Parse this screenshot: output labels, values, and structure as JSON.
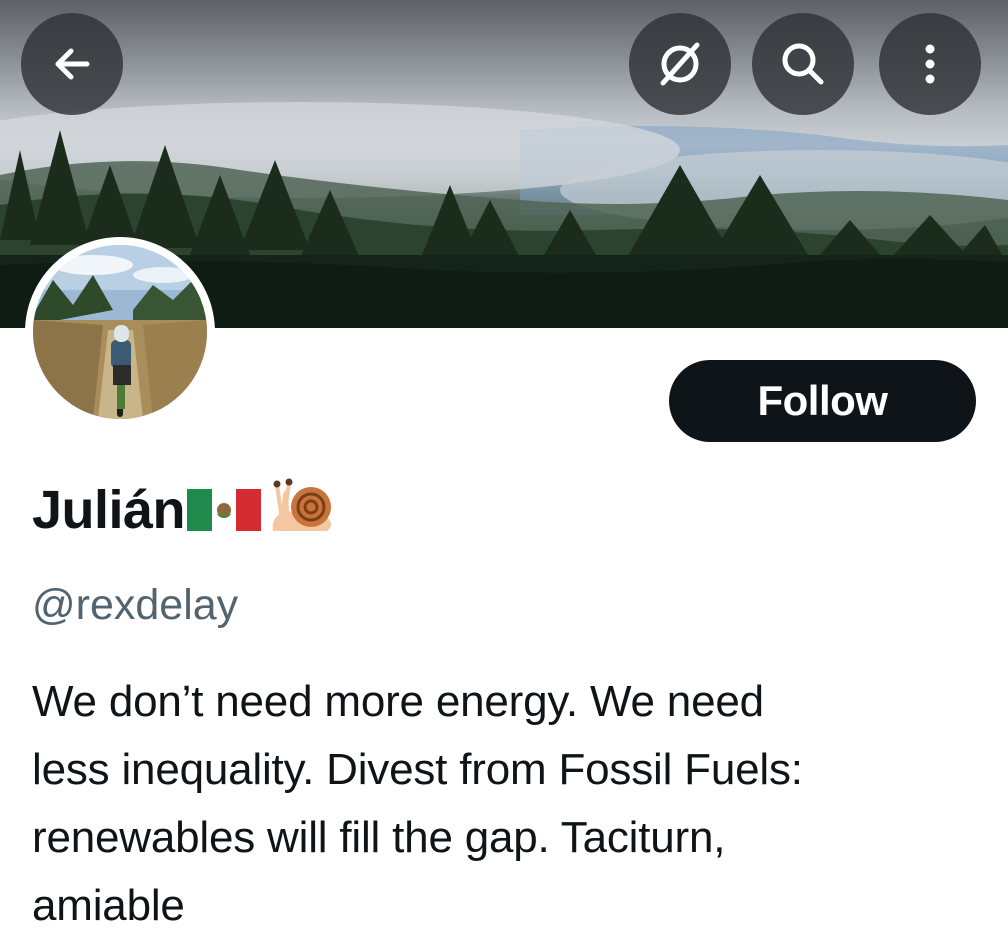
{
  "header": {
    "back_icon": "arrow-left-icon",
    "actions": [
      {
        "icon": "grok-slash-icon"
      },
      {
        "icon": "search-icon"
      },
      {
        "icon": "more-vertical-icon"
      }
    ],
    "banner_description": "misty pine forest"
  },
  "profile": {
    "display_name": "Julián",
    "name_emojis": [
      "mexico-flag",
      "snail"
    ],
    "handle": "@rexdelay",
    "follow_label": "Follow",
    "bio_lines": [
      "We don’t need more energy. We need",
      "less inequality. Divest from Fossil Fuels:",
      "renewables will fill the gap. Taciturn,",
      "amiable"
    ]
  },
  "colors": {
    "follow_bg": "#0f1419",
    "handle_text": "#536471",
    "button_overlay": "#303236"
  }
}
